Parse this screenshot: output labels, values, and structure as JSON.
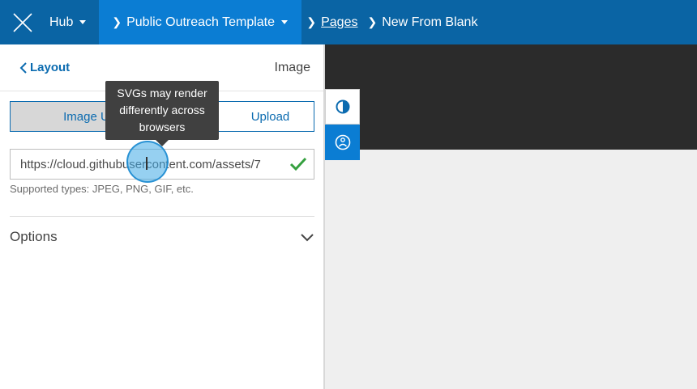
{
  "header": {
    "hub_label": "Hub",
    "site_name": "Public Outreach Template",
    "pages_link": "Pages",
    "current_page": "New From Blank",
    "colors": {
      "bar": "#0a64a4",
      "active_crumb": "#0b7dd3"
    }
  },
  "panel": {
    "back_label": "Layout",
    "title": "Image",
    "segment": {
      "option_1": "Image U",
      "option_2": "Upload"
    },
    "url_value": "https://cloud.githubusercontent.com/assets/7",
    "hint": "Supported types: JPEG, PNG, GIF, etc.",
    "options_label": "Options"
  },
  "tooltip": {
    "line1": "SVGs may render",
    "line2": "differently across",
    "line3": "browsers"
  },
  "icons": {
    "logo": "x-logo-icon",
    "contrast": "contrast-icon",
    "accessibility": "accessibility-icon"
  }
}
